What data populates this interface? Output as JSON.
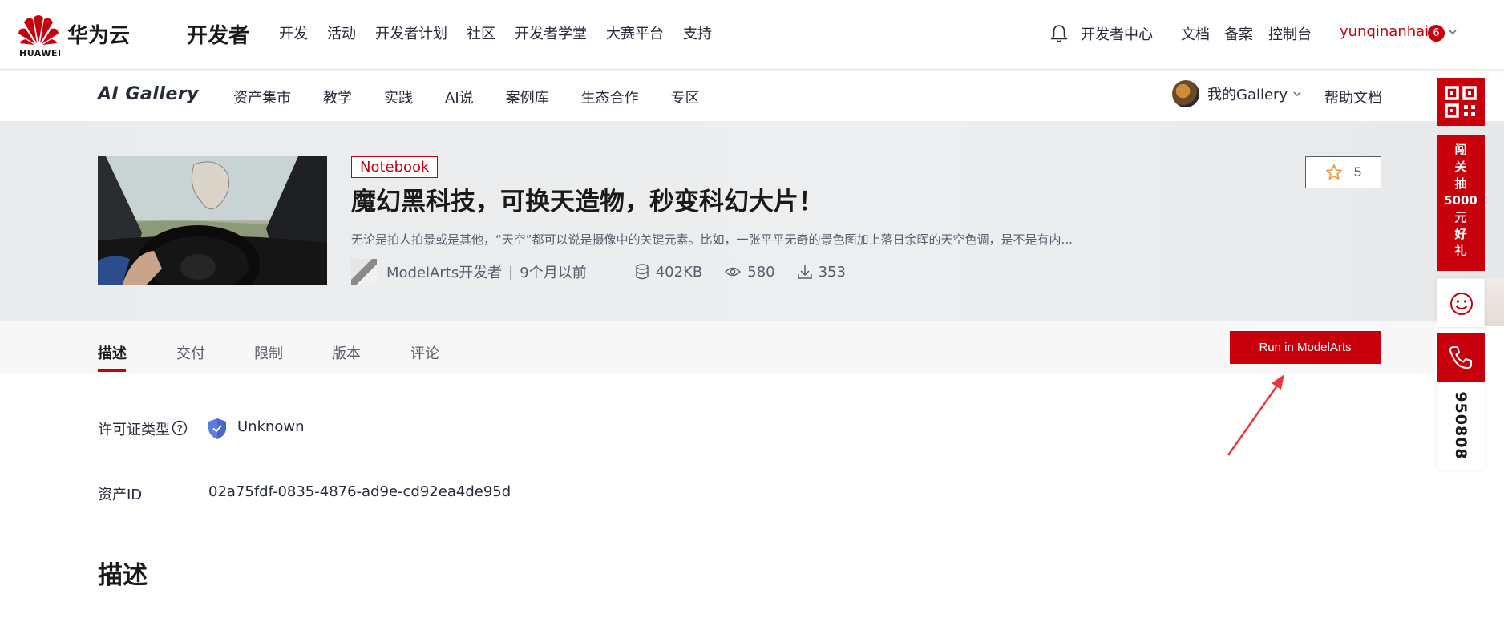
{
  "top_header": {
    "brand_small": "HUAWEI",
    "brand_cn": "华为云",
    "section_title": "开发者",
    "nav": [
      "开发",
      "活动",
      "开发者计划",
      "社区",
      "开发者学堂",
      "大赛平台",
      "支持"
    ],
    "dev_center": "开发者中心",
    "docs": "文档",
    "beian": "备案",
    "console": "控制台",
    "username": "yunqinanhai",
    "notification_count": "6",
    "accent": "#c7000b"
  },
  "sub_header": {
    "brand": "AI Gallery",
    "nav": [
      "资产集市",
      "教学",
      "实践",
      "AI说",
      "案例库",
      "生态合作",
      "专区"
    ],
    "my_gallery": "我的Gallery",
    "help": "帮助文档"
  },
  "hero": {
    "tag": "Notebook",
    "title": "魔幻黑科技，可换天造物，秒变科幻大片！",
    "description": "无论是拍人拍景或是其他，“天空”都可以说是摄像中的关键元素。比如，一张平平无奇的景色图加上落日余晖的天空色调，是不是有内...",
    "author": "ModelArts开发者",
    "separator": "|",
    "time_ago": "9个月以前",
    "size": "402KB",
    "views": "580",
    "downloads": "353",
    "stars": "5"
  },
  "tabs": {
    "items": [
      "描述",
      "交付",
      "限制",
      "版本",
      "评论"
    ],
    "active": "描述",
    "run_button": "Run in ModelArts"
  },
  "content": {
    "license_label": "许可证类型",
    "license_value": "Unknown",
    "asset_id_label": "资产ID",
    "asset_id_value": "02a75fdf-0835-4876-ad9e-cd92ea4de95d",
    "section_title": "描述"
  },
  "sidebar": {
    "promo_text": [
      "闯",
      "关",
      "抽",
      "5000",
      "元",
      "好",
      "礼"
    ],
    "phone_number": "950808"
  }
}
